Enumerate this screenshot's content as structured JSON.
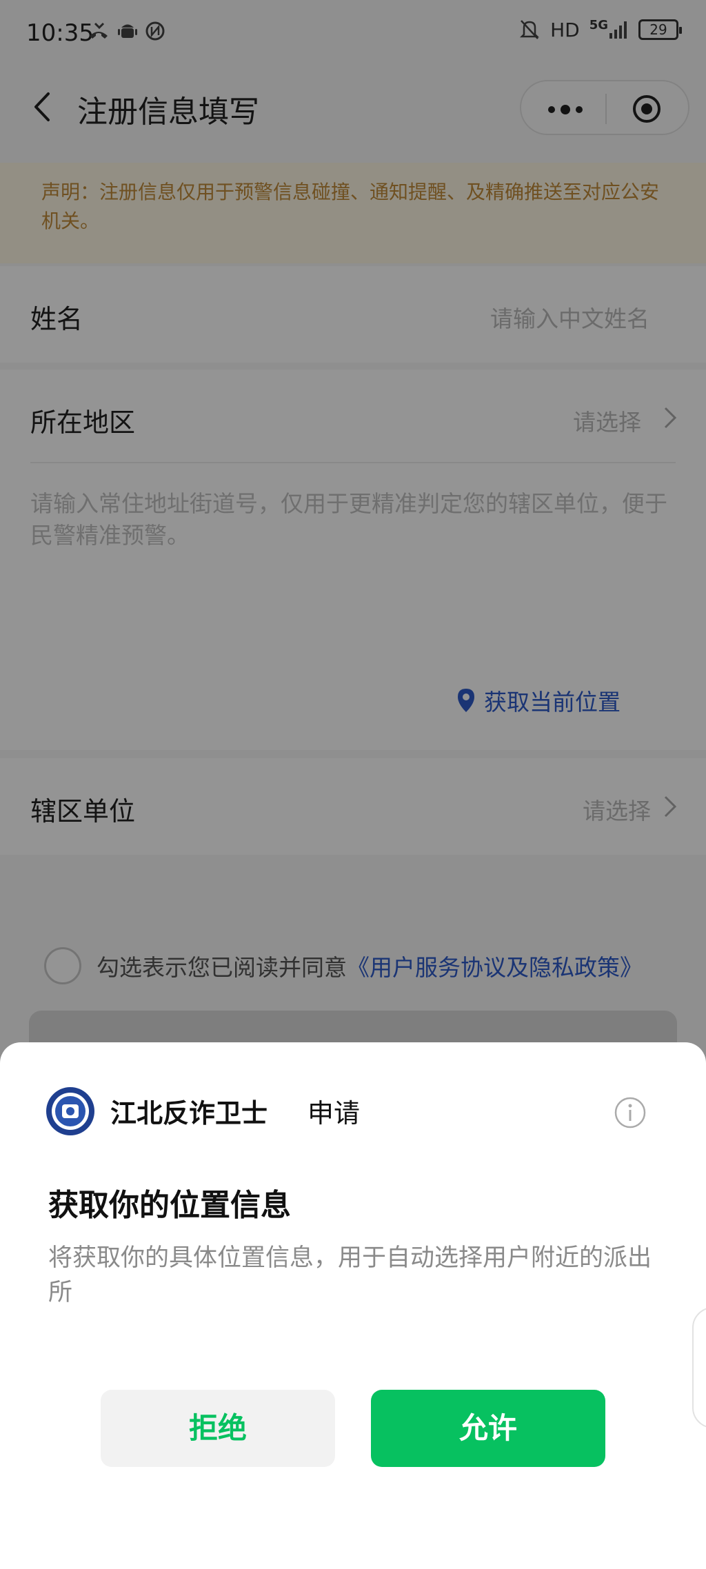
{
  "status_bar": {
    "time": "10:35",
    "hd": "HD",
    "network": "5G",
    "battery": "29",
    "icons": [
      "missed-call-icon",
      "android-icon",
      "nfc-icon",
      "mute-bell-icon",
      "signal-icon"
    ]
  },
  "nav": {
    "title": "注册信息填写",
    "icons": [
      "back-arrow-icon",
      "more-dots-icon",
      "target-icon"
    ]
  },
  "notice": "声明：注册信息仅用于预警信息碰撞、通知提醒、及精确推送至对应公安机关。",
  "form": {
    "name": {
      "label": "姓名",
      "placeholder": "请输入中文姓名"
    },
    "region": {
      "label": "所在地区",
      "value": "请选择",
      "address_hint": "请输入常住地址街道号，仅用于更精准判定您的辖区单位，便于民警精准预警。",
      "locate_label": "获取当前位置"
    },
    "unit": {
      "label": "辖区单位",
      "value": "请选择"
    }
  },
  "agreement": {
    "text": "勾选表示您已阅读并同意",
    "link": "《用户服务协议及隐私政策》"
  },
  "sheet": {
    "app_name": "江北反诈卫士",
    "apply": "申请",
    "title": "获取你的位置信息",
    "description": "将获取你的具体位置信息，用于自动选择用户附近的派出所",
    "deny_label": "拒绝",
    "allow_label": "允许"
  },
  "colors": {
    "accent_green": "#07c160",
    "link_blue": "#2e5bc8",
    "notice_text": "#c08a3a",
    "notice_bg": "#fdf6e3"
  }
}
